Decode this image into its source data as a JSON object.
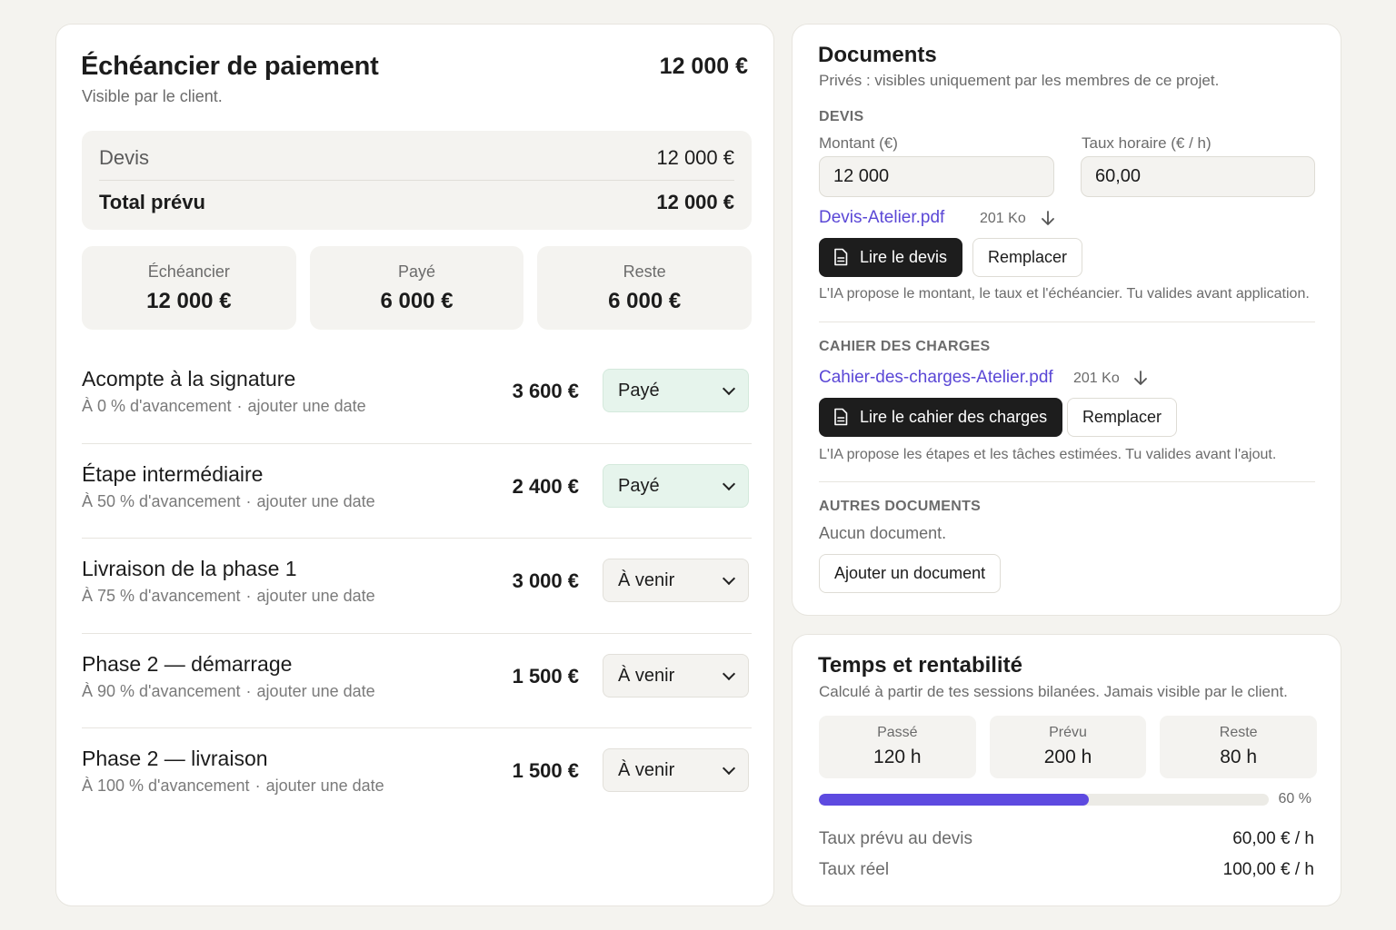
{
  "schedule": {
    "title": "Échéancier de paiement",
    "subtitle": "Visible par le client.",
    "total": "12 000 €",
    "summary": {
      "quote_label": "Devis",
      "quote_value": "12 000 €",
      "planned_label": "Total prévu",
      "planned_value": "12 000 €"
    },
    "stats": [
      {
        "label": "Échéancier",
        "value": "12 000 €"
      },
      {
        "label": "Payé",
        "value": "6 000 €"
      },
      {
        "label": "Reste",
        "value": "6 000 €"
      }
    ],
    "milestones": [
      {
        "name": "Acompte à la signature",
        "progress": "À 0 % d'avancement",
        "date_link": "ajouter une date",
        "amount": "3 600 €",
        "status": "Payé"
      },
      {
        "name": "Étape intermédiaire",
        "progress": "À 50 % d'avancement",
        "date_link": "ajouter une date",
        "amount": "2 400 €",
        "status": "Payé"
      },
      {
        "name": "Livraison de la phase 1",
        "progress": "À 75 % d'avancement",
        "date_link": "ajouter une date",
        "amount": "3 000 €",
        "status": "À venir"
      },
      {
        "name": "Phase 2 — démarrage",
        "progress": "À 90 % d'avancement",
        "date_link": "ajouter une date",
        "amount": "1 500 €",
        "status": "À venir"
      },
      {
        "name": "Phase 2 — livraison",
        "progress": "À 100 % d'avancement",
        "date_link": "ajouter une date",
        "amount": "1 500 €",
        "status": "À venir"
      }
    ],
    "separator": "·"
  },
  "documents": {
    "title": "Documents",
    "subtitle": "Privés : visibles uniquement par les membres de ce projet.",
    "quote": {
      "heading": "DEVIS",
      "amount_label": "Montant (€)",
      "amount_value": "12 000",
      "rate_label": "Taux horaire (€ / h)",
      "rate_value": "60,00",
      "file_name": "Devis-Atelier.pdf",
      "file_size": "201 Ko",
      "read_button": "Lire le devis",
      "replace_button": "Remplacer",
      "note": "L'IA propose le montant, le taux et l'échéancier. Tu valides avant application."
    },
    "spec": {
      "heading": "CAHIER DES CHARGES",
      "file_name": "Cahier-des-charges-Atelier.pdf",
      "file_size": "201 Ko",
      "read_button": "Lire le cahier des charges",
      "replace_button": "Remplacer",
      "note": "L'IA propose les étapes et les tâches estimées. Tu valides avant l'ajout."
    },
    "other": {
      "heading": "AUTRES DOCUMENTS",
      "empty": "Aucun document.",
      "add_button": "Ajouter un document"
    }
  },
  "time": {
    "title": "Temps et rentabilité",
    "subtitle": "Calculé à partir de tes sessions bilanées. Jamais visible par le client.",
    "stats": [
      {
        "label": "Passé",
        "value": "120 h"
      },
      {
        "label": "Prévu",
        "value": "200 h"
      },
      {
        "label": "Reste",
        "value": "80 h"
      }
    ],
    "progress_fraction": 0.6,
    "progress_label": "60 %",
    "planned_rate_label": "Taux prévu au devis",
    "planned_rate_value": "60,00 € / h",
    "real_rate_label": "Taux réel",
    "real_rate_value": "100,00 € / h"
  },
  "colors": {
    "accent": "#5d4ae0",
    "link": "#5a47d6",
    "paid_bg": "#e6f4ec",
    "dark_button": "#1d1d1d"
  },
  "icons": {
    "status_chevron": "chevron-down-icon",
    "download": "download-icon",
    "document": "document-icon"
  }
}
